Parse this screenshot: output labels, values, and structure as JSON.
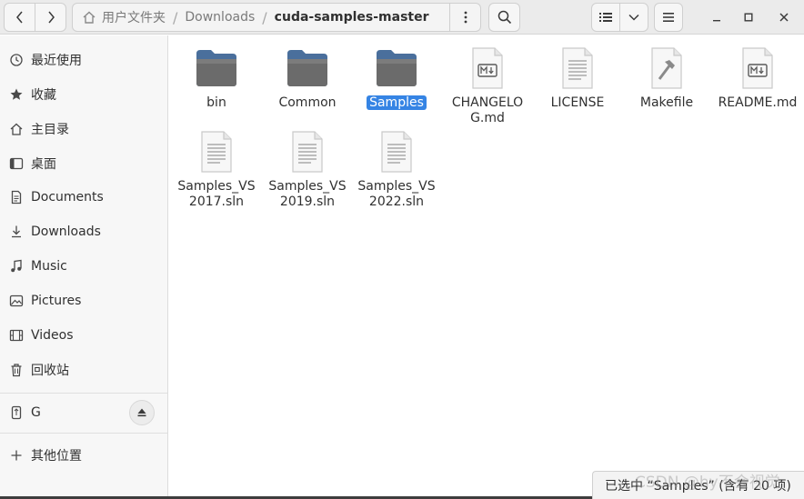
{
  "header": {
    "path": [
      "用户文件夹",
      "Downloads",
      "cuda-samples-master"
    ],
    "separator": "/"
  },
  "sidebar": {
    "items": [
      {
        "label": "最近使用",
        "icon": "recent-icon"
      },
      {
        "label": "收藏",
        "icon": "star-icon"
      },
      {
        "label": "主目录",
        "icon": "home-icon"
      },
      {
        "label": "桌面",
        "icon": "desktop-icon"
      },
      {
        "label": "Documents",
        "icon": "document-icon"
      },
      {
        "label": "Downloads",
        "icon": "download-icon"
      },
      {
        "label": "Music",
        "icon": "music-icon"
      },
      {
        "label": "Pictures",
        "icon": "pictures-icon"
      },
      {
        "label": "Videos",
        "icon": "videos-icon"
      },
      {
        "label": "回收站",
        "icon": "trash-icon"
      }
    ],
    "devices": [
      {
        "label": "G",
        "icon": "usb-drive-icon"
      }
    ],
    "other": {
      "label": "其他位置",
      "icon": "plus-icon"
    }
  },
  "files": [
    {
      "name": "bin",
      "type": "folder"
    },
    {
      "name": "Common",
      "type": "folder"
    },
    {
      "name": "Samples",
      "type": "folder",
      "selected": true
    },
    {
      "name": "CHANGELOG.md",
      "type": "markdown"
    },
    {
      "name": "LICENSE",
      "type": "text"
    },
    {
      "name": "Makefile",
      "type": "makefile"
    },
    {
      "name": "README.md",
      "type": "markdown"
    },
    {
      "name": "Samples_VS2017.sln",
      "type": "text"
    },
    {
      "name": "Samples_VS2019.sln",
      "type": "text"
    },
    {
      "name": "Samples_VS2022.sln",
      "type": "text"
    }
  ],
  "status": {
    "text": "已选中 “Samples” (含有 20 项)"
  },
  "watermark": "CSDN @hy不会视觉",
  "colors": {
    "accent": "#3584e4",
    "folder": "#5c7fa8",
    "headerbar": "#ebebeb",
    "sidebar": "#f7f7f7"
  }
}
